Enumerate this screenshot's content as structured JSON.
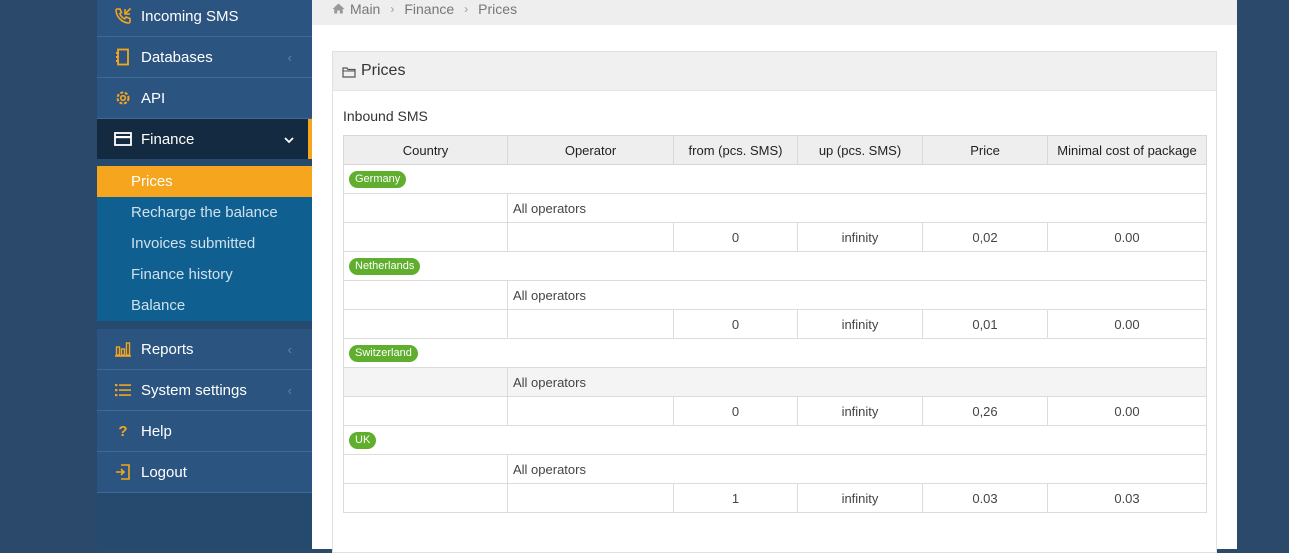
{
  "sidebar": {
    "items": [
      {
        "label": "Incoming SMS"
      },
      {
        "label": "Databases"
      },
      {
        "label": "API"
      },
      {
        "label": "Finance"
      },
      {
        "label": "Reports"
      },
      {
        "label": "System settings"
      },
      {
        "label": "Help"
      },
      {
        "label": "Logout"
      }
    ],
    "finance_sub": [
      {
        "label": "Prices"
      },
      {
        "label": "Recharge the balance"
      },
      {
        "label": "Invoices submitted"
      },
      {
        "label": "Finance history"
      },
      {
        "label": "Balance"
      }
    ]
  },
  "breadcrumb": [
    "Main",
    "Finance",
    "Prices"
  ],
  "panel": {
    "title": "Prices",
    "subtitle": "Inbound SMS"
  },
  "table": {
    "headers": [
      "Country",
      "Operator",
      "from (pcs. SMS)",
      "up (pcs. SMS)",
      "Price",
      "Minimal cost of package"
    ],
    "countries": [
      {
        "name": "Germany",
        "operator": "All operators",
        "from": "0",
        "up": "infinity",
        "price": "0,02",
        "min": "0.00"
      },
      {
        "name": "Netherlands",
        "operator": "All operators",
        "from": "0",
        "up": "infinity",
        "price": "0,01",
        "min": "0.00"
      },
      {
        "name": "Switzerland",
        "operator": "All operators",
        "from": "0",
        "up": "infinity",
        "price": "0,26",
        "min": "0.00"
      },
      {
        "name": "UK",
        "operator": "All operators",
        "from": "1",
        "up": "infinity",
        "price": "0.03",
        "min": "0.03"
      }
    ]
  },
  "colors": {
    "accent": "#f5a51e",
    "badge": "#5fae2e",
    "sidebar": "#2b5580"
  },
  "icons": {
    "chevron_left": "‹",
    "chevron_down": "⌄",
    "breadcrumb_sep": "›"
  }
}
